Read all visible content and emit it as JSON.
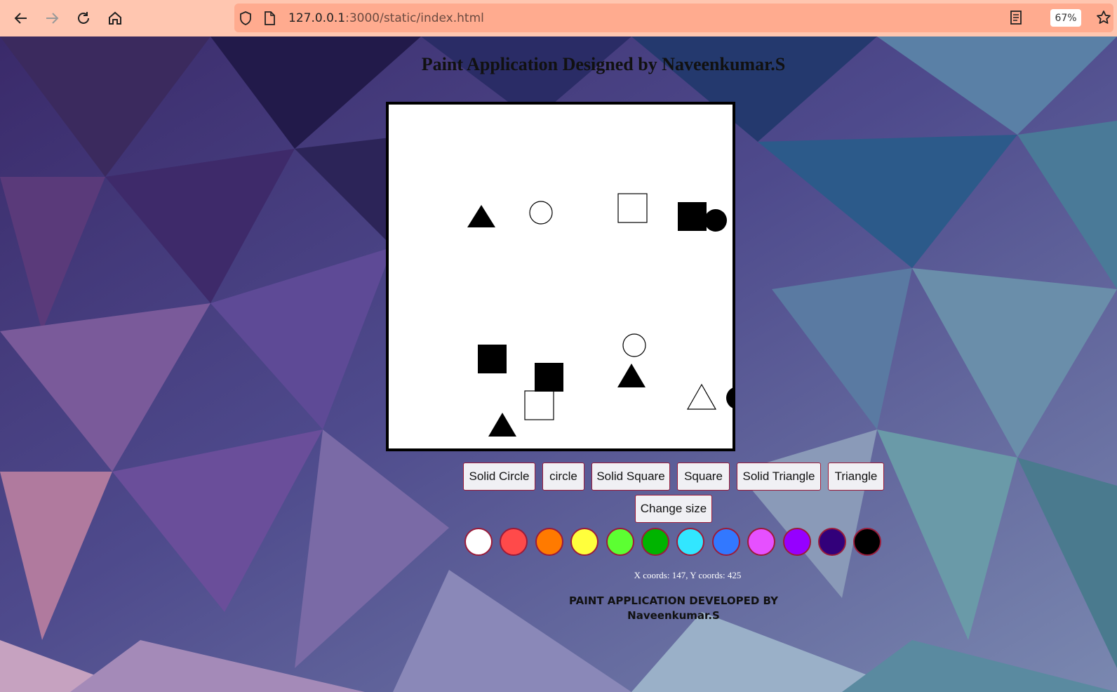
{
  "browser": {
    "url_host": "127.0.0.1",
    "url_rest": ":3000/static/index.html",
    "zoom": "67%"
  },
  "page": {
    "title": "Paint Application Designed by Naveenkumar.S",
    "coords_text": "X coords: 147, Y coords: 425",
    "footer_line1": "PAINT APPLICATION DEVELOPED BY",
    "footer_line2": "Naveenkumar.S"
  },
  "toolbar": {
    "solid_circle": "Solid Circle",
    "circle": "circle",
    "solid_square": "Solid Square",
    "square": "Square",
    "solid_triangle": "Solid Triangle",
    "triangle": "Triangle",
    "change_size": "Change size"
  },
  "colors": [
    "#ffffff",
    "#ff4a4a",
    "#ff7a00",
    "#ffff3c",
    "#5cff32",
    "#00b400",
    "#32e6ff",
    "#3278ff",
    "#e650ff",
    "#9600ff",
    "#32007a",
    "#000000"
  ],
  "canvas_shapes": [
    "solid-triangle",
    "circle",
    "square",
    "solid-square",
    "solid-circle",
    "solid-square",
    "solid-square",
    "circle",
    "solid-triangle",
    "square",
    "solid-triangle",
    "triangle",
    "solid-circle"
  ]
}
